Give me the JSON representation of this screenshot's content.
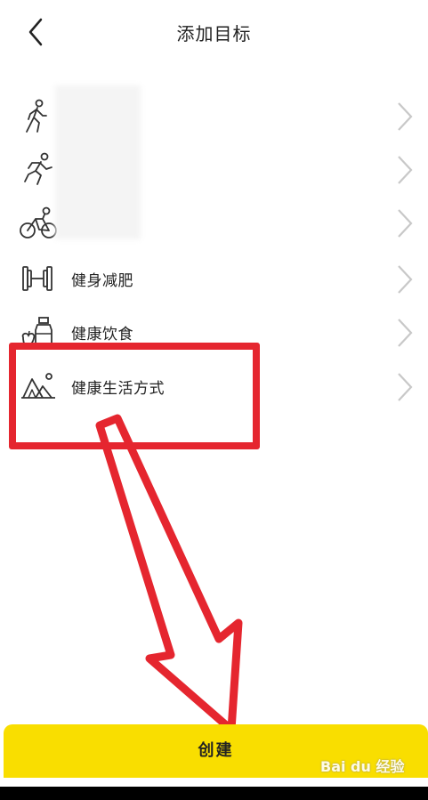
{
  "header": {
    "title": "添加目标"
  },
  "goals": [
    {
      "label": "",
      "icon": "walk-icon"
    },
    {
      "label": "",
      "icon": "run-icon"
    },
    {
      "label": "",
      "icon": "cycling-icon"
    },
    {
      "label": "健身减肥",
      "icon": "dumbbell-icon"
    },
    {
      "label": "健康饮食",
      "icon": "food-icon"
    },
    {
      "label": "健康生活方式",
      "icon": "lifestyle-icon"
    }
  ],
  "footer": {
    "create_label": "创建"
  },
  "watermark": "Bai du 经验",
  "colors": {
    "accent": "#f9de00",
    "annotation": "#e5262f"
  }
}
